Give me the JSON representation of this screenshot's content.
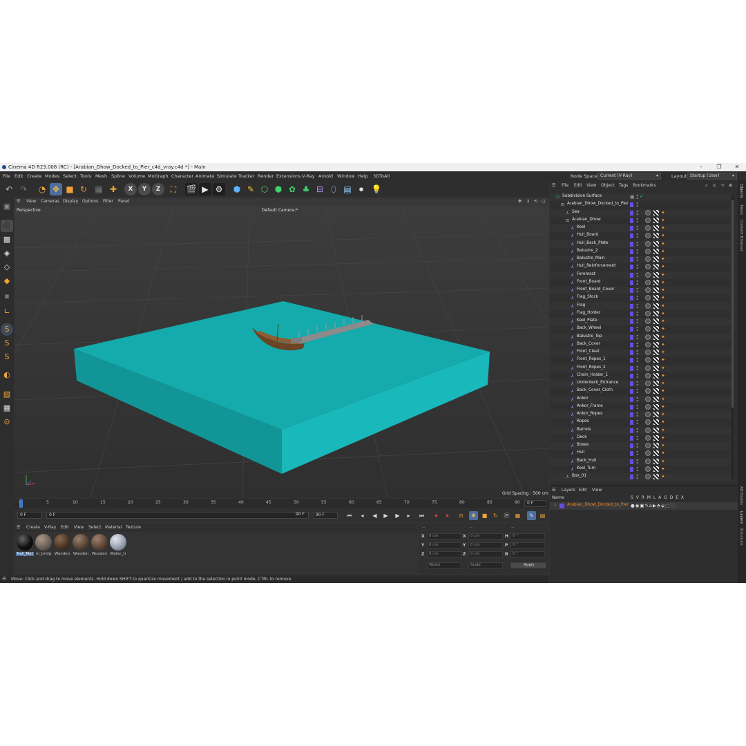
{
  "window": {
    "title": "Cinema 4D R23.008 (RC) - [Arabian_Dhow_Docked_to_Pier_c4d_vray.c4d *] - Main",
    "controls": [
      "–",
      "❐",
      "✕"
    ]
  },
  "menubar": {
    "items": [
      "File",
      "Edit",
      "Create",
      "Modes",
      "Select",
      "Tools",
      "Mesh",
      "Spline",
      "Volume",
      "MoGraph",
      "Character",
      "Animate",
      "Simulate",
      "Tracker",
      "Render",
      "Extensions",
      "V-Ray",
      "Arnold",
      "Window",
      "Help",
      "3DToAll"
    ],
    "node_space_label": "Node Space:",
    "node_space_value": "Current (V-Ray)",
    "layout_label": "Layout:",
    "layout_value": "Startup (User)"
  },
  "toolbar": {
    "axis_x": "X",
    "axis_y": "Y",
    "axis_z": "Z"
  },
  "viewport": {
    "menu": [
      "View",
      "Cameras",
      "Display",
      "Options",
      "Filter",
      "Panel"
    ],
    "name": "Perspective",
    "camera": "Default Camera",
    "camera_suffix": ":*",
    "grid_spacing": "Grid Spacing : 500 cm",
    "accent_cyan": "#14a6a8"
  },
  "timeline": {
    "ticks": [
      "0",
      "5",
      "10",
      "15",
      "20",
      "25",
      "30",
      "35",
      "40",
      "45",
      "50",
      "55",
      "60",
      "65",
      "70",
      "75",
      "80",
      "85",
      "90"
    ],
    "current_frame": "0 F",
    "start_frame": "0 F",
    "start_field": "0 F",
    "end_field": "90 F",
    "end_frame": "90 F",
    "right_frame": "0 F"
  },
  "materials": {
    "menu": [
      "Create",
      "V-Ray",
      "Edit",
      "View",
      "Select",
      "Material",
      "Texture"
    ],
    "items": [
      {
        "label": "Nail_Mat",
        "color": "#121212"
      },
      {
        "label": "m_bridg",
        "color": "#6e6258"
      },
      {
        "label": "Wooden",
        "color": "#4a3425"
      },
      {
        "label": "Wooden",
        "color": "#5a4535"
      },
      {
        "label": "Wooden",
        "color": "#5f4637"
      },
      {
        "label": "Water_tr",
        "color": "#9aa2b0"
      }
    ]
  },
  "coordinates": {
    "header_left": "--",
    "header_mid": "--",
    "header_right": "--",
    "rows": [
      {
        "a": "X",
        "av": "0 cm",
        "b": "X",
        "bv": "0 cm",
        "c": "H",
        "cv": "0 °"
      },
      {
        "a": "Y",
        "av": "0 cm",
        "b": "Y",
        "bv": "0 cm",
        "c": "P",
        "cv": "0 °"
      },
      {
        "a": "Z",
        "av": "0 cm",
        "b": "Z",
        "bv": "0 cm",
        "c": "B",
        "cv": "0 °"
      }
    ],
    "mode1": "World",
    "mode2": "Scale",
    "apply": "Apply"
  },
  "status": {
    "text": "Move: Click and drag to move elements. Hold down SHIFT to quantize movement / add to the selection in point mode, CTRL to remove."
  },
  "objects_panel": {
    "menu": [
      "File",
      "Edit",
      "View",
      "Object",
      "Tags",
      "Bookmarks"
    ],
    "top_rows": [
      {
        "name": "Subdivision Surface",
        "indent": 0
      },
      {
        "name": "Arabian_Dhow_Docked_to_Pier",
        "indent": 1
      },
      {
        "name": "Sea",
        "indent": 2
      },
      {
        "name": "Arabian_Dhow",
        "indent": 2
      }
    ],
    "children": [
      "Keel",
      "Hull_Board",
      "Hull_Back_Plate",
      "Balustre_2",
      "Balustre_Main",
      "Hull_Reinforcement",
      "Foremast",
      "Front_Board",
      "Front_Board_Cover",
      "Flag_Stock",
      "Flag",
      "Flag_Holder",
      "Keel_Plate",
      "Back_Wheel",
      "Balustre_Top",
      "Back_Cover",
      "Front_Cleat",
      "Front_Ropes_1",
      "Front_Ropes_2",
      "Chain_Holder_1",
      "Underdeck_Entrance",
      "Back_Cover_Cloth",
      "Ankor",
      "Ankor_Frame",
      "Ankor_Ropes",
      "Ropes",
      "Barrels",
      "Deck",
      "Boxes",
      "Hull",
      "Back_Hull",
      "Keel_Turn"
    ],
    "last_row": "Box_01"
  },
  "layers_panel": {
    "menu": [
      "Layers",
      "Edit",
      "View"
    ],
    "name_header": "Name",
    "columns": "S V R M L A G D E X",
    "layer_name": "Arabian_Dhow_Docked_to_Pier",
    "layer_color": "#6b4ce0"
  },
  "side_tabs": [
    "Objects",
    "Takes",
    "Content Browser",
    "Attributes",
    "Layers",
    "Structure"
  ]
}
